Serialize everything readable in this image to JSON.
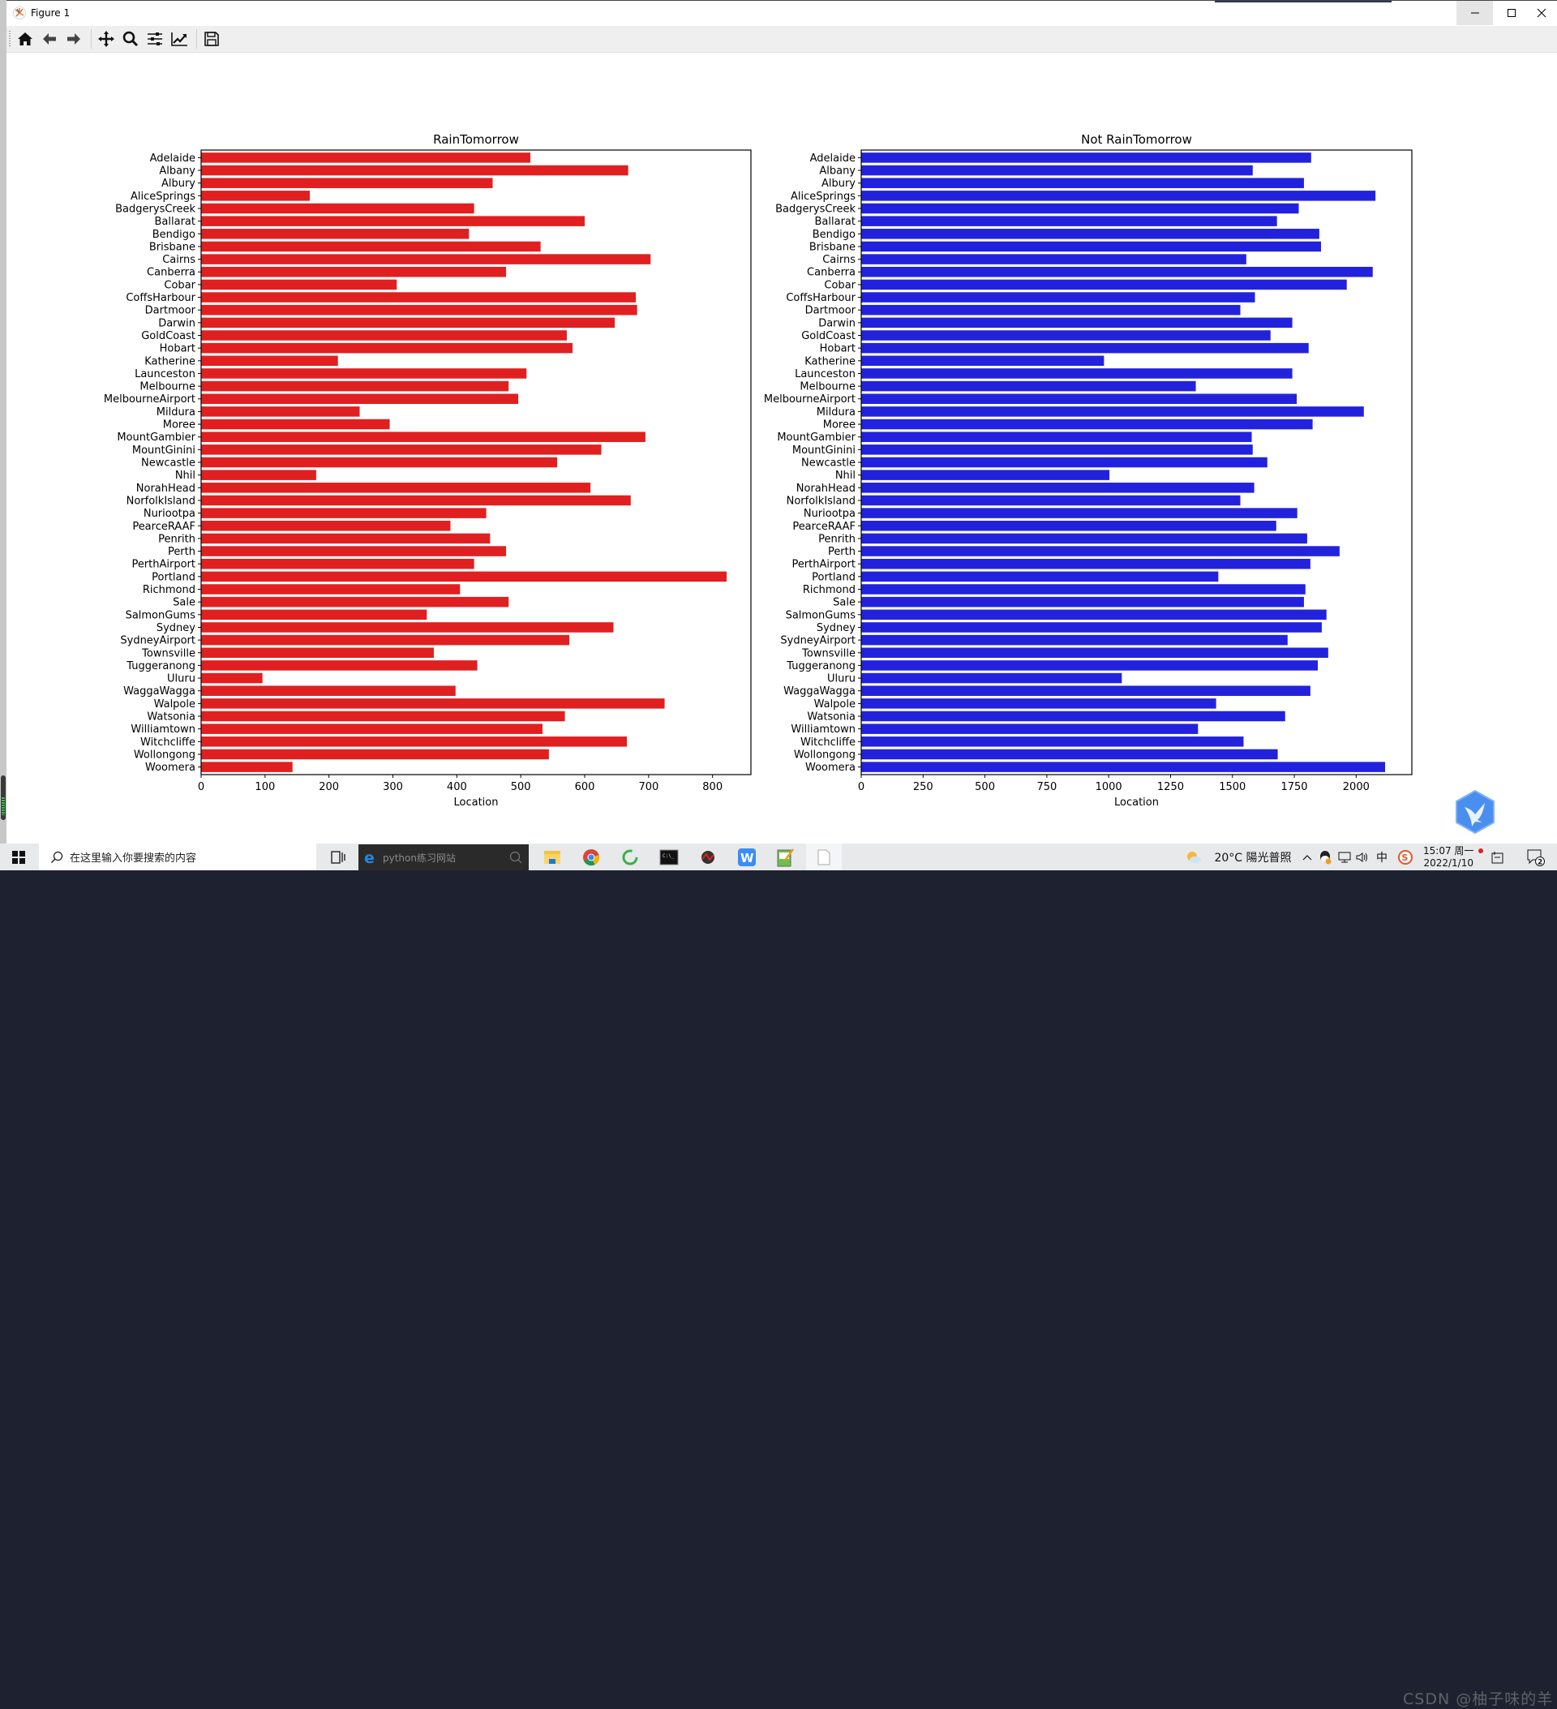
{
  "window": {
    "title": "Figure 1",
    "controls": {
      "minimize": "minimize-icon",
      "maximize": "maximize-icon",
      "close": "close-icon"
    }
  },
  "toolbar": {
    "buttons": [
      {
        "name": "home",
        "icon": "home-icon"
      },
      {
        "name": "back",
        "icon": "arrow-left-icon"
      },
      {
        "name": "forward",
        "icon": "arrow-right-icon"
      },
      {
        "name": "pan",
        "icon": "move-icon"
      },
      {
        "name": "zoom",
        "icon": "zoom-icon"
      },
      {
        "name": "configure-subplots",
        "icon": "sliders-icon"
      },
      {
        "name": "edit-axis",
        "icon": "line-chart-icon"
      },
      {
        "name": "save",
        "icon": "save-icon"
      }
    ]
  },
  "chart_data": [
    {
      "type": "bar",
      "orientation": "horizontal",
      "title": "RainTomorrow",
      "xlabel": "Location",
      "ylabel": "",
      "color": "#e02020",
      "xlim": [
        0,
        860
      ],
      "xticks": [
        0,
        100,
        200,
        300,
        400,
        500,
        600,
        700,
        800
      ],
      "grid": false,
      "categories": [
        "Adelaide",
        "Albany",
        "Albury",
        "AliceSprings",
        "BadgerysCreek",
        "Ballarat",
        "Bendigo",
        "Brisbane",
        "Cairns",
        "Canberra",
        "Cobar",
        "CoffsHarbour",
        "Dartmoor",
        "Darwin",
        "GoldCoast",
        "Hobart",
        "Katherine",
        "Launceston",
        "Melbourne",
        "MelbourneAirport",
        "Mildura",
        "Moree",
        "MountGambier",
        "MountGinini",
        "Newcastle",
        "Nhil",
        "NorahHead",
        "NorfolkIsland",
        "Nuriootpa",
        "PearceRAAF",
        "Penrith",
        "Perth",
        "PerthAirport",
        "Portland",
        "Richmond",
        "Sale",
        "SalmonGums",
        "Sydney",
        "SydneyAirport",
        "Townsville",
        "Tuggeranong",
        "Uluru",
        "WaggaWagga",
        "Walpole",
        "Watsonia",
        "Williamtown",
        "Witchcliffe",
        "Wollongong",
        "Woomera"
      ],
      "values": [
        515,
        668,
        456,
        170,
        427,
        600,
        419,
        531,
        703,
        477,
        306,
        680,
        682,
        647,
        572,
        581,
        214,
        509,
        481,
        496,
        248,
        295,
        695,
        626,
        557,
        180,
        609,
        672,
        446,
        390,
        452,
        477,
        427,
        822,
        405,
        481,
        353,
        645,
        576,
        364,
        432,
        96,
        398,
        725,
        569,
        534,
        666,
        544,
        143
      ]
    },
    {
      "type": "bar",
      "orientation": "horizontal",
      "title": "Not RainTomorrow",
      "xlabel": "Location",
      "ylabel": "",
      "color": "#2222dd",
      "xlim": [
        0,
        2225
      ],
      "xticks": [
        0,
        250,
        500,
        750,
        1000,
        1250,
        1500,
        1750,
        2000
      ],
      "grid": false,
      "categories": [
        "Adelaide",
        "Albany",
        "Albury",
        "AliceSprings",
        "BadgerysCreek",
        "Ballarat",
        "Bendigo",
        "Brisbane",
        "Cairns",
        "Canberra",
        "Cobar",
        "CoffsHarbour",
        "Dartmoor",
        "Darwin",
        "GoldCoast",
        "Hobart",
        "Katherine",
        "Launceston",
        "Melbourne",
        "MelbourneAirport",
        "Mildura",
        "Moree",
        "MountGambier",
        "MountGinini",
        "Newcastle",
        "Nhil",
        "NorahHead",
        "NorfolkIsland",
        "Nuriootpa",
        "PearceRAAF",
        "Penrith",
        "Perth",
        "PerthAirport",
        "Portland",
        "Richmond",
        "Sale",
        "SalmonGums",
        "Sydney",
        "SydneyAirport",
        "Townsville",
        "Tuggeranong",
        "Uluru",
        "WaggaWagga",
        "Walpole",
        "Watsonia",
        "Williamtown",
        "Witchcliffe",
        "Wollongong",
        "Woomera"
      ],
      "values": [
        1818,
        1582,
        1789,
        2078,
        1768,
        1680,
        1851,
        1858,
        1556,
        2067,
        1962,
        1591,
        1532,
        1742,
        1654,
        1808,
        981,
        1742,
        1352,
        1760,
        2031,
        1824,
        1578,
        1582,
        1641,
        1003,
        1588,
        1532,
        1762,
        1677,
        1802,
        1933,
        1815,
        1443,
        1795,
        1789,
        1880,
        1861,
        1723,
        1887,
        1845,
        1053,
        1815,
        1434,
        1713,
        1361,
        1545,
        1683,
        2117
      ]
    }
  ],
  "taskbar": {
    "search_placeholder": "在这里输入你要搜索的内容",
    "ie_address": "python练习网站",
    "apps": [
      "file-explorer-icon",
      "chrome-icon",
      "refresh-app-icon",
      "terminal-icon",
      "app-icon",
      "wps-icon",
      "notepad-icon",
      "blank-document-icon"
    ],
    "weather": "20°C 陽光普照",
    "ime": "中",
    "time": "15:07 周一",
    "date": "2022/1/10",
    "notification_count": "2",
    "watermark": "CSDN @柚子味的羊"
  }
}
